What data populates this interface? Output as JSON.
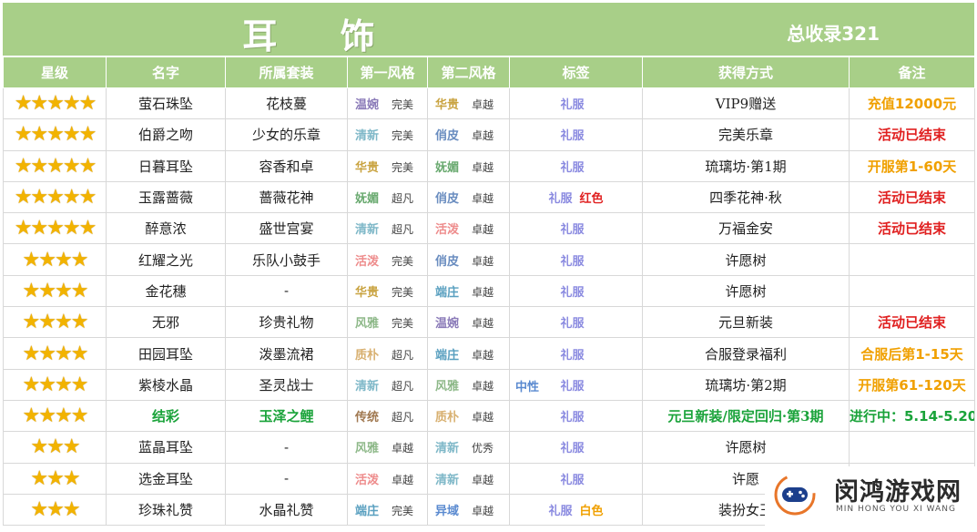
{
  "header": {
    "title": "耳 饰",
    "total": "总收录321"
  },
  "columns": [
    "星级",
    "名字",
    "所属套装",
    "第一风格",
    "第二风格",
    "标签",
    "获得方式",
    "备注"
  ],
  "style_colors": {
    "温婉": "#8a7ab8",
    "华贵": "#c9a340",
    "清新": "#7fb8c8",
    "俏皮": "#6a8dc0",
    "妩媚": "#6aaa70",
    "活泼": "#ee8c8c",
    "风雅": "#8db888",
    "端庄": "#5aa0c0",
    "质朴": "#d8b070",
    "传统": "#a07850",
    "异域": "#5a8ad0",
    "中性": "#5a8ad0"
  },
  "label_color": "#8a8ae0",
  "note_colors": {
    "orange": "#f0a000",
    "red": "#e02020"
  },
  "rows": [
    {
      "stars": "★★★★★",
      "name": "萤石珠坠",
      "set": "花枝蔓",
      "s1": "温婉",
      "l1": "完美",
      "s2": "华贵",
      "l2": "卓越",
      "prefix": "",
      "label": "礼服",
      "extra": "",
      "extraColor": "",
      "source": "VIP9赠送",
      "note": "充值12000元",
      "noteColor": "#f0a000",
      "green": false
    },
    {
      "stars": "★★★★★",
      "name": "伯爵之吻",
      "set": "少女的乐章",
      "s1": "清新",
      "l1": "完美",
      "s2": "俏皮",
      "l2": "卓越",
      "prefix": "",
      "label": "礼服",
      "extra": "",
      "extraColor": "",
      "source": "完美乐章",
      "note": "活动已结束",
      "noteColor": "#e02020",
      "green": false
    },
    {
      "stars": "★★★★★",
      "name": "日暮耳坠",
      "set": "容香和卓",
      "s1": "华贵",
      "l1": "完美",
      "s2": "妩媚",
      "l2": "卓越",
      "prefix": "",
      "label": "礼服",
      "extra": "",
      "extraColor": "",
      "source": "琉璃坊·第1期",
      "note": "开服第1-60天",
      "noteColor": "#f0a000",
      "green": false
    },
    {
      "stars": "★★★★★",
      "name": "玉露蔷薇",
      "set": "蔷薇花神",
      "s1": "妩媚",
      "l1": "超凡",
      "s2": "俏皮",
      "l2": "卓越",
      "prefix": "",
      "label": "礼服",
      "extra": "红色",
      "extraColor": "#e02020",
      "source": "四季花神·秋",
      "note": "活动已结束",
      "noteColor": "#e02020",
      "green": false
    },
    {
      "stars": "★★★★★",
      "name": "醉意浓",
      "set": "盛世宫宴",
      "s1": "清新",
      "l1": "超凡",
      "s2": "活泼",
      "l2": "卓越",
      "prefix": "",
      "label": "礼服",
      "extra": "",
      "extraColor": "",
      "source": "万福金安",
      "note": "活动已结束",
      "noteColor": "#e02020",
      "green": false
    },
    {
      "stars": "★★★★",
      "name": "红耀之光",
      "set": "乐队小鼓手",
      "s1": "活泼",
      "l1": "完美",
      "s2": "俏皮",
      "l2": "卓越",
      "prefix": "",
      "label": "礼服",
      "extra": "",
      "extraColor": "",
      "source": "许愿树",
      "note": "",
      "noteColor": "",
      "green": false
    },
    {
      "stars": "★★★★",
      "name": "金花穗",
      "set": "-",
      "s1": "华贵",
      "l1": "完美",
      "s2": "端庄",
      "l2": "卓越",
      "prefix": "",
      "label": "礼服",
      "extra": "",
      "extraColor": "",
      "source": "许愿树",
      "note": "",
      "noteColor": "",
      "green": false
    },
    {
      "stars": "★★★★",
      "name": "无邪",
      "set": "珍贵礼物",
      "s1": "风雅",
      "l1": "完美",
      "s2": "温婉",
      "l2": "卓越",
      "prefix": "",
      "label": "礼服",
      "extra": "",
      "extraColor": "",
      "source": "元旦新装",
      "note": "活动已结束",
      "noteColor": "#e02020",
      "green": false
    },
    {
      "stars": "★★★★",
      "name": "田园耳坠",
      "set": "泼墨流裙",
      "s1": "质朴",
      "l1": "超凡",
      "s2": "端庄",
      "l2": "卓越",
      "prefix": "",
      "label": "礼服",
      "extra": "",
      "extraColor": "",
      "source": "合服登录福利",
      "note": "合服后第1-15天",
      "noteColor": "#f0a000",
      "green": false
    },
    {
      "stars": "★★★★",
      "name": "紫棱水晶",
      "set": "圣灵战士",
      "s1": "清新",
      "l1": "超凡",
      "s2": "风雅",
      "l2": "卓越",
      "prefix": "中性",
      "label": "礼服",
      "extra": "",
      "extraColor": "",
      "source": "琉璃坊·第2期",
      "note": "开服第61-120天",
      "noteColor": "#f0a000",
      "green": false
    },
    {
      "stars": "★★★★",
      "name": "结彩",
      "set": "玉泽之鲤",
      "s1": "传统",
      "l1": "超凡",
      "s2": "质朴",
      "l2": "卓越",
      "prefix": "",
      "label": "礼服",
      "extra": "",
      "extraColor": "",
      "source": "元旦新装/限定回归·第3期",
      "note": "进行中：5.14-5.20",
      "noteColor": "#1aa33a",
      "green": true
    },
    {
      "stars": "★★★",
      "name": "蓝晶耳坠",
      "set": "-",
      "s1": "风雅",
      "l1": "卓越",
      "s2": "清新",
      "l2": "优秀",
      "prefix": "",
      "label": "礼服",
      "extra": "",
      "extraColor": "",
      "source": "许愿树",
      "note": "",
      "noteColor": "",
      "green": false
    },
    {
      "stars": "★★★",
      "name": "选金耳坠",
      "set": "-",
      "s1": "活泼",
      "l1": "卓越",
      "s2": "清新",
      "l2": "卓越",
      "prefix": "",
      "label": "礼服",
      "extra": "",
      "extraColor": "",
      "source": "许愿",
      "note": "",
      "noteColor": "",
      "green": false
    },
    {
      "stars": "★★★",
      "name": "珍珠礼赞",
      "set": "水晶礼赞",
      "s1": "端庄",
      "l1": "完美",
      "s2": "异域",
      "l2": "卓越",
      "prefix": "",
      "label": "礼服",
      "extra": "白色",
      "extraColor": "#f0a000",
      "source": "装扮女王",
      "note": "",
      "noteColor": "",
      "green": false
    }
  ],
  "watermark": {
    "big": "闵鸿游戏网",
    "small": "MIN HONG YOU XI WANG",
    "icon": "gamepad-logo-icon"
  }
}
